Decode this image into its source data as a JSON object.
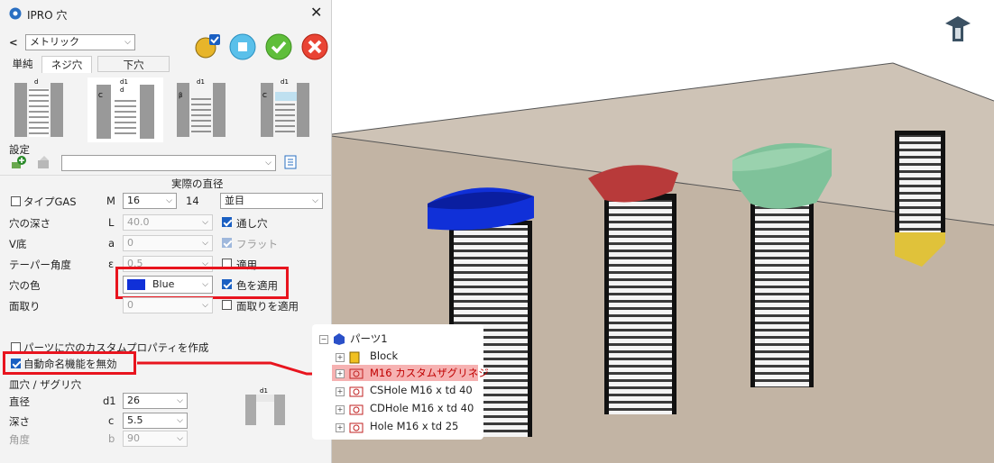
{
  "dialog": {
    "title": "IPRO 穴",
    "standard": "メトリック",
    "tabs": [
      "単純",
      "ネジ穴",
      "下穴"
    ],
    "settings_label": "設定",
    "actual_diameter_label": "実際の直径",
    "rows": {
      "type_gas": "タイプGAS",
      "m_prefix": "M",
      "m_value": "16",
      "m_actual": "14",
      "pitch": "並目",
      "depth_label": "穴の深さ",
      "depth_var": "L",
      "depth_value": "40.0",
      "through_label": "通し穴",
      "vbottom_label": "V底",
      "vbottom_var": "a",
      "vbottom_value": "0",
      "flat_label": "フラット",
      "taper_label": "テーパー角度",
      "taper_var": "ε",
      "taper_value": "0.5",
      "apply_label": "適用",
      "color_label": "穴の色",
      "color_value": "Blue",
      "apply_color_label": "色を適用",
      "chamfer_label": "面取り",
      "chamfer_value": "0",
      "apply_chamfer_label": "面取りを適用",
      "custom_prop_label": "パーツに穴のカスタムプロパティを作成",
      "disable_naming_label": "自動命名機能を無効",
      "counter_label": "皿穴 / ザグリ穴",
      "diam_label": "直径",
      "diam_var": "d1",
      "diam_value": "26",
      "cdepth_label": "深さ",
      "cdepth_var": "c",
      "cdepth_value": "5.5",
      "angle_label": "角度",
      "angle_var": "b",
      "angle_value": "90"
    }
  },
  "tree": {
    "root": "パーツ1",
    "items": [
      "Block",
      "M16 カスタムザグリネジ",
      "CSHole M16 x td 40",
      "CDHole M16 x td 40",
      "Hole M16 x td 25"
    ]
  },
  "colors": {
    "highlight_red": "#e8141e",
    "hole_blue": "#1030d8",
    "hole_red": "#b83a3a",
    "hole_green": "#7fc29a",
    "hole_yellow": "#e0c23a",
    "block": "#c9bdb0"
  }
}
